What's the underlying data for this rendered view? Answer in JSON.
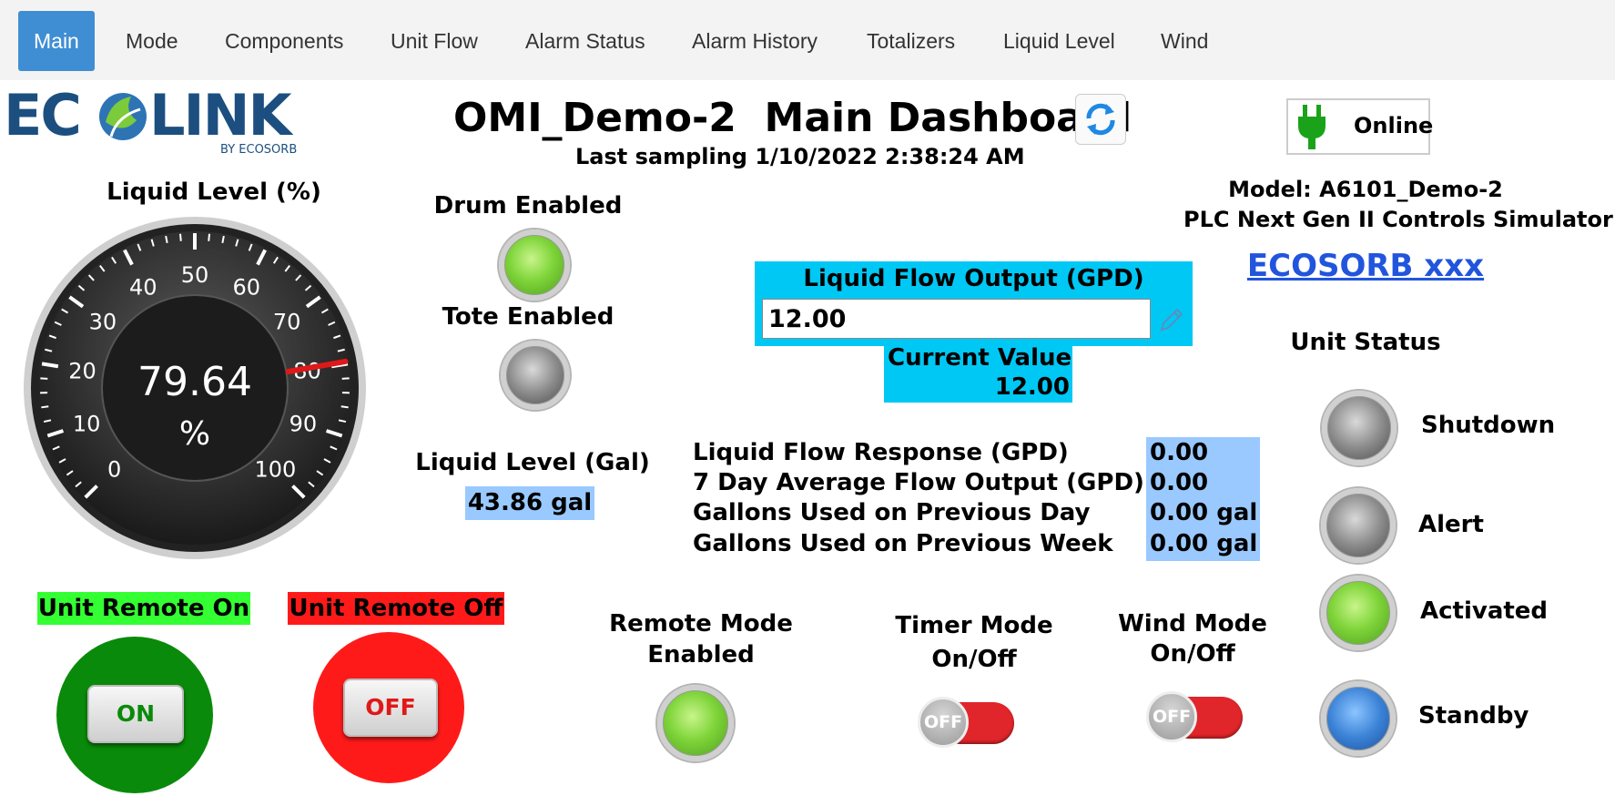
{
  "nav": {
    "items": [
      "Main",
      "Mode",
      "Components",
      "Unit Flow",
      "Alarm Status",
      "Alarm History",
      "Totalizers",
      "Liquid Level",
      "Wind"
    ]
  },
  "header": {
    "title_unit": "OMI_Demo-2",
    "title_suffix": "Main Dashboard",
    "last_sampling": "Last sampling 1/10/2022 2:38:24 AM",
    "connection_status": "Online"
  },
  "model": {
    "model_line": "Model: A6101_Demo-2",
    "controller_line": "PLC Next Gen II Controls Simulator",
    "link_text": "ECOSORB xxx"
  },
  "gauge": {
    "title": "Liquid Level (%)",
    "value": "79.64",
    "unit": "%",
    "ticks": [
      "0",
      "10",
      "20",
      "30",
      "40",
      "50",
      "60",
      "70",
      "80",
      "90",
      "100"
    ],
    "value_num": 79.64
  },
  "indicators": {
    "drum_label": "Drum Enabled",
    "drum_state": "green",
    "tote_label": "Tote Enabled",
    "tote_state": "gray"
  },
  "liquid_level_gal": {
    "label": "Liquid Level (Gal)",
    "value": "43.86 gal"
  },
  "flow_output": {
    "label": "Liquid Flow Output (GPD)",
    "input_value": "12.00",
    "current_label": "Current Value",
    "current_value": "12.00"
  },
  "stats": [
    {
      "label": "Liquid Flow Response (GPD)",
      "value": "0.00"
    },
    {
      "label": "7 Day Average Flow Output (GPD)",
      "value": "0.00"
    },
    {
      "label": "Gallons Used on Previous Day",
      "value": "0.00 gal"
    },
    {
      "label": "Gallons Used on Previous Week",
      "value": "0.00 gal"
    }
  ],
  "unit_status": {
    "title": "Unit Status",
    "items": [
      {
        "label": "Shutdown",
        "state": "gray"
      },
      {
        "label": "Alert",
        "state": "gray"
      },
      {
        "label": "Activated",
        "state": "green"
      },
      {
        "label": "Standby",
        "state": "blue"
      }
    ]
  },
  "remote": {
    "on_label": "Unit Remote On",
    "on_button": "ON",
    "off_label": "Unit Remote Off",
    "off_button": "OFF"
  },
  "modes": {
    "remote_mode_line1": "Remote Mode",
    "remote_mode_line2": "Enabled",
    "timer_mode_line1": "Timer Mode",
    "timer_mode_line2": "On/Off",
    "timer_toggle": "OFF",
    "wind_mode_line1": "Wind Mode",
    "wind_mode_line2": "On/Off",
    "wind_toggle": "OFF"
  },
  "colors": {
    "nav_active": "#3f8ed3",
    "cyan_panel": "#00c8f5",
    "value_box": "#99c9ff",
    "remote_on": "#0a8a0a",
    "remote_off": "#ff1a1a",
    "remote_on_label_bg": "#33ff33",
    "remote_off_label_bg": "#ff1a1a",
    "link": "#2255dd"
  },
  "logo": {
    "wordmark": "ECOLINK",
    "byline": "BY ECOSORB"
  }
}
